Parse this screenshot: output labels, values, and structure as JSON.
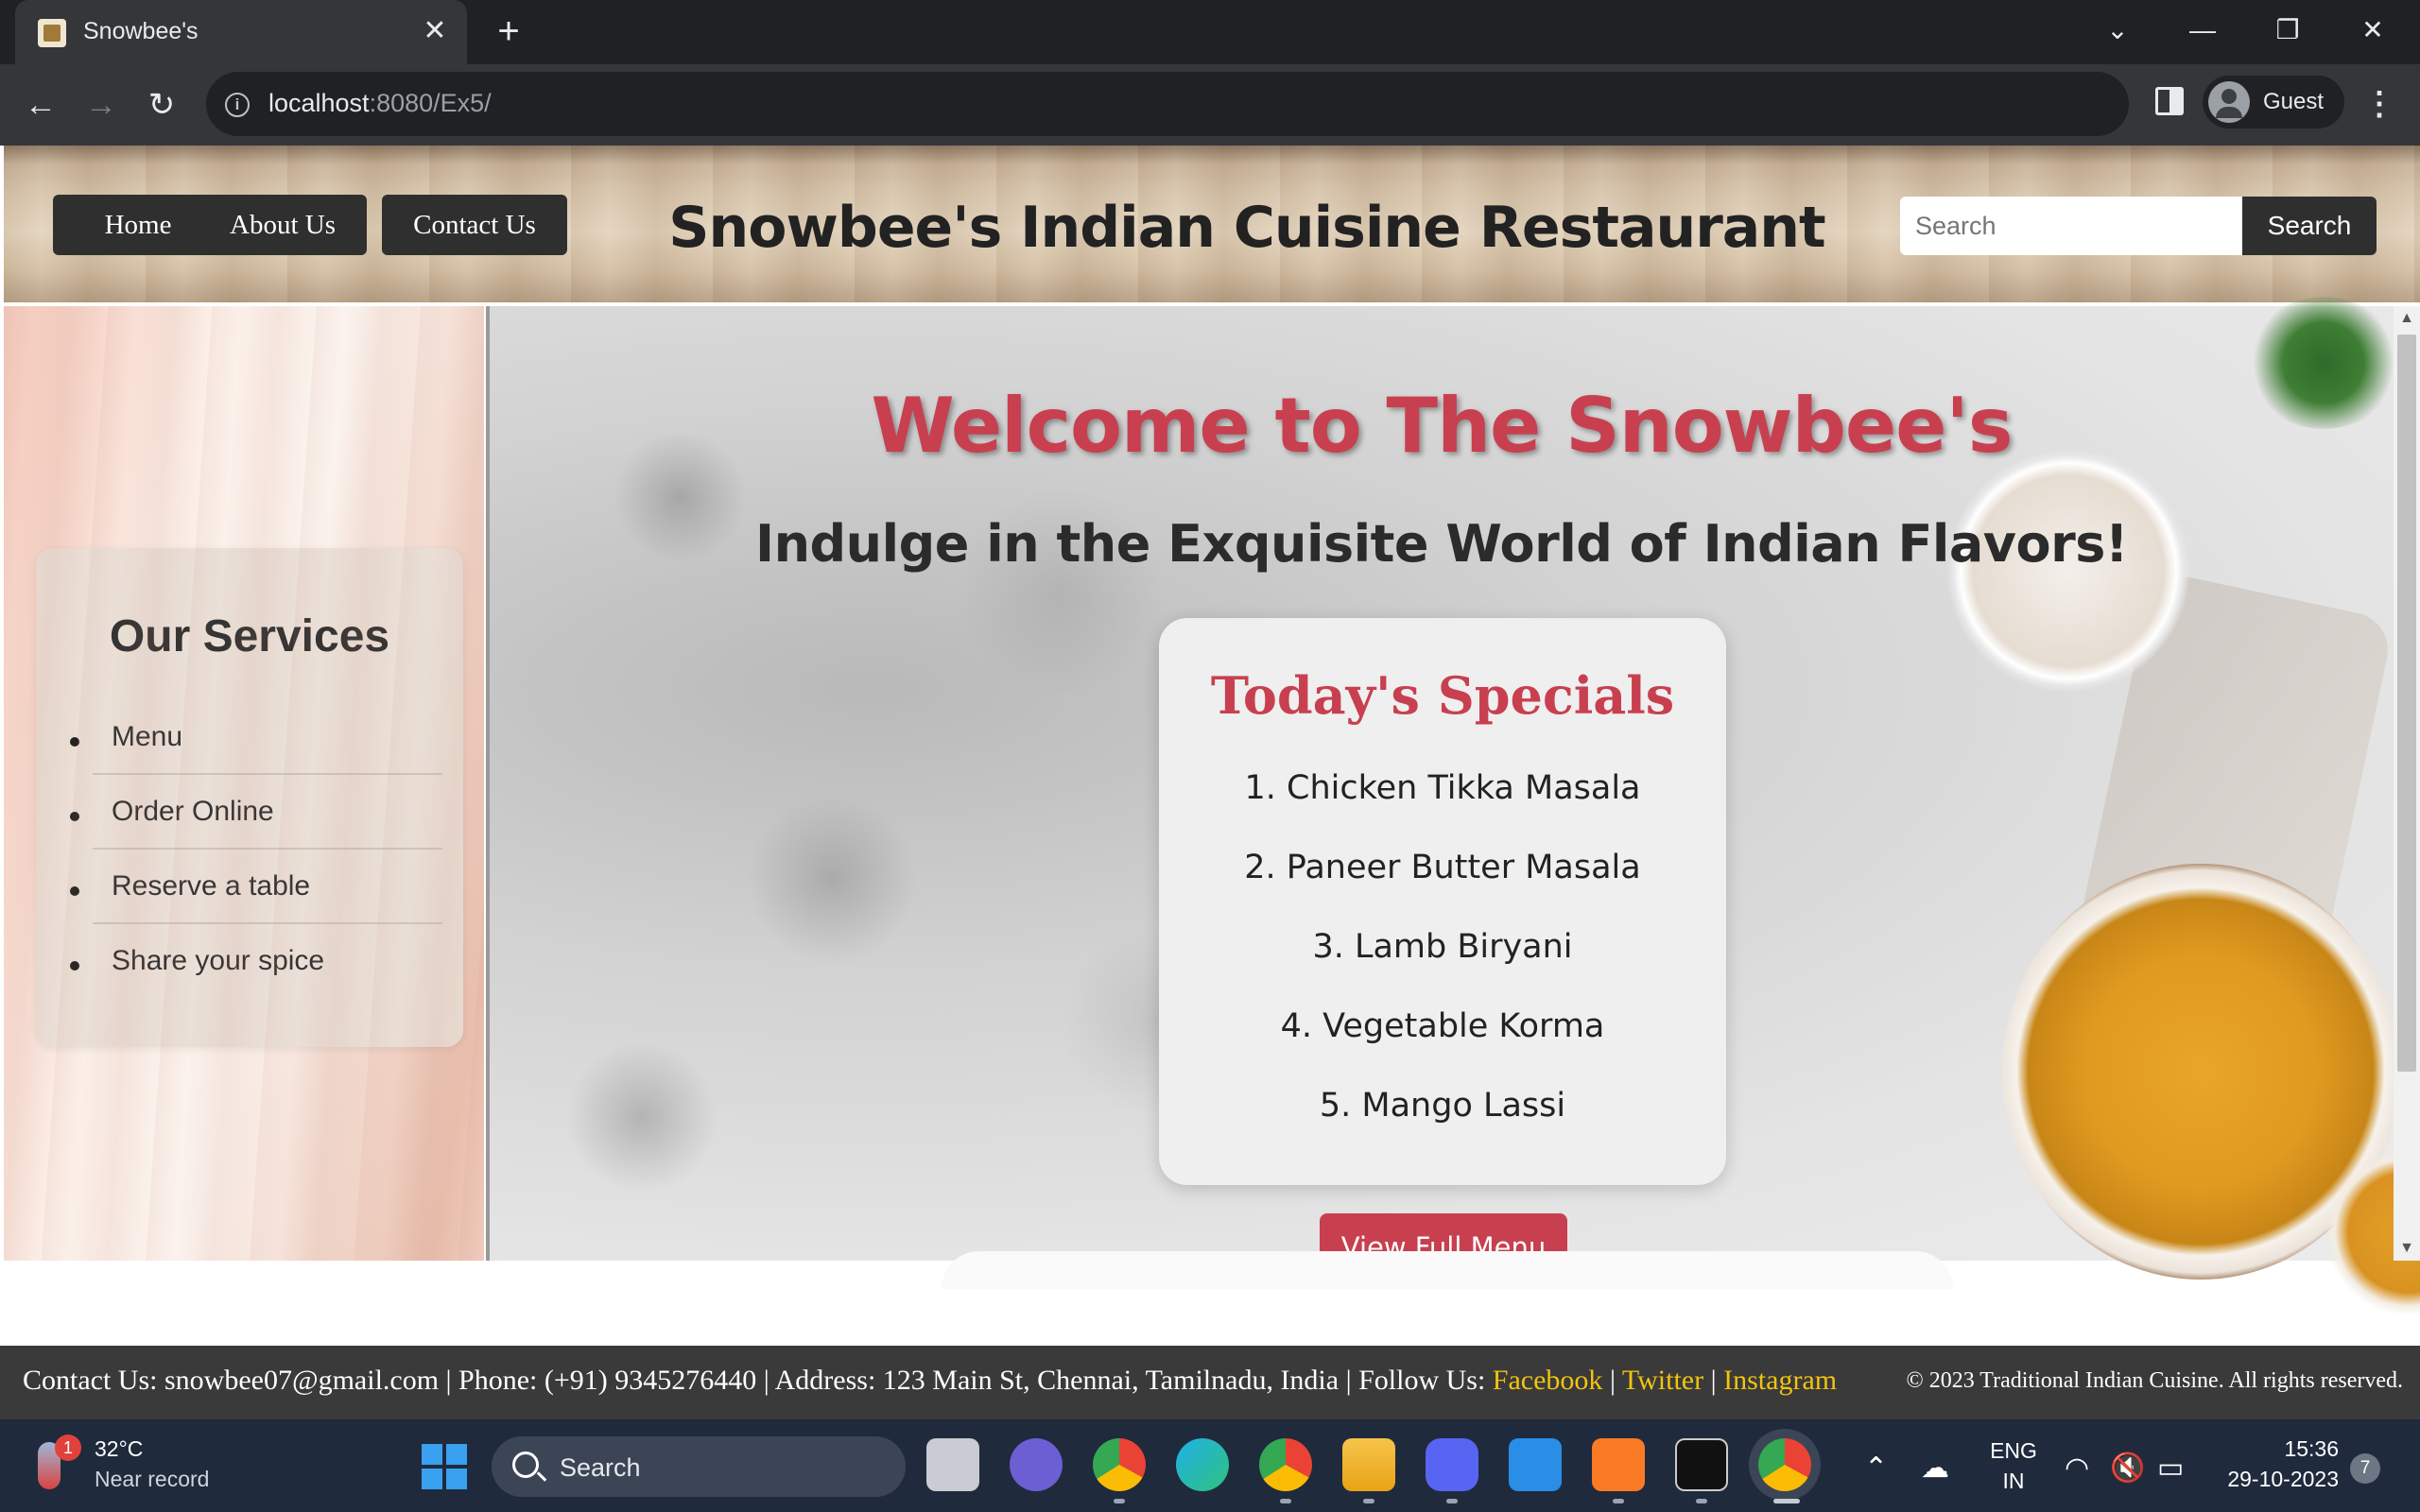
{
  "browser": {
    "tab_title": "Snowbee's",
    "tab_close": "✕",
    "new_tab": "+",
    "url_host": "localhost",
    "url_path": ":8080/Ex5/",
    "profile_label": "Guest",
    "window_controls": {
      "dropdown": "⌄",
      "minimize": "—",
      "restore": "❐",
      "close": "✕"
    }
  },
  "site": {
    "nav": [
      "Home",
      "About Us",
      "Contact Us"
    ],
    "title": "Snowbee's Indian Cuisine Restaurant",
    "search_placeholder": "Search",
    "search_button": "Search"
  },
  "services": {
    "title": "Our Services",
    "items": [
      "Menu",
      "Order Online",
      "Reserve a table",
      "Share your spice"
    ]
  },
  "hero": {
    "welcome": "Welcome to The Snowbee's",
    "tagline": "Indulge in the Exquisite World of Indian Flavors!",
    "specials_title": "Today's Specials",
    "specials": [
      "1. Chicken Tikka Masala",
      "2. Paneer Butter Masala",
      "3. Lamb Biryani",
      "4. Vegetable Korma",
      "5. Mango Lassi"
    ],
    "cta": "View Full Menu"
  },
  "footer": {
    "contact_prefix": "Contact Us: snowbee07@gmail.com | Phone: (+91) 9345276440 | Address: 123 Main St, Chennai, Tamilnadu, India | Follow Us: ",
    "links": [
      "Facebook",
      "Twitter",
      "Instagram"
    ],
    "separator": " | ",
    "copyright": "© 2023 Traditional Indian Cuisine. All rights reserved."
  },
  "taskbar": {
    "weather_temp": "32°C",
    "weather_desc": "Near record",
    "weather_badge": "1",
    "search_label": "Search",
    "lang_top": "ENG",
    "lang_bottom": "IN",
    "time": "15:36",
    "date": "29-10-2023",
    "notification_count": "7",
    "apps": [
      "file-explorer-gray",
      "zoom",
      "chrome",
      "edge",
      "chrome-profile",
      "files",
      "discord",
      "vscode",
      "xampp",
      "terminal",
      "chrome-active"
    ]
  },
  "colors": {
    "accent_red": "#c8404f",
    "nav_dark": "#2f2f2f",
    "footer_bg": "#3a3a3a",
    "footer_link": "#f1c40f"
  }
}
